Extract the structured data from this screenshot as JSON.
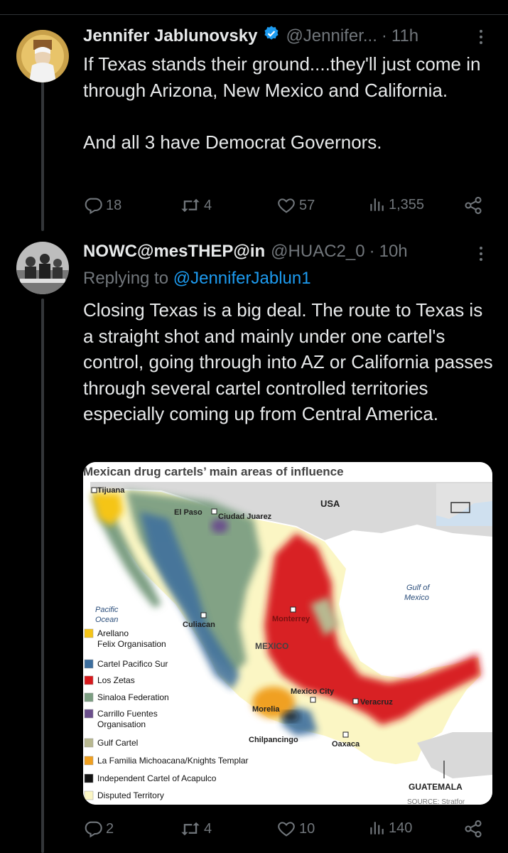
{
  "tweet1": {
    "name": "Jennifer Jablunovsky",
    "handle": "@Jennifer...",
    "time": "11h",
    "text": "If Texas stands their ground....they'll just come in through Arizona, New Mexico and California.\n\nAnd all 3 have Democrat Governors.",
    "replies": "18",
    "retweets": "4",
    "likes": "57",
    "views": "1,355"
  },
  "tweet2": {
    "name": "NOWC@mesTHEP@in",
    "handle": "@HUAC2_0",
    "time": "10h",
    "replying_prefix": "Replying to ",
    "replying_to": "@JenniferJablun1",
    "text": "Closing Texas is a big deal. The route to Texas is a straight shot and mainly under one cartel's control, going through into AZ or California passes through several cartel controlled territories especially coming up from Central America.",
    "replies": "2",
    "retweets": "4",
    "likes": "10",
    "views": "140"
  },
  "map": {
    "title": "Mexican drug cartels’ main areas of influence",
    "labels": {
      "tijuana": "Tijuana",
      "el_paso": "El Paso",
      "ciudad_juarez": "Ciudad Juarez",
      "usa": "USA",
      "gulf_1": "Gulf of",
      "gulf_2": "Mexico",
      "pacific_1": "Pacific",
      "pacific_2": "Ocean",
      "culiacan": "Culiacan",
      "monterrey": "Monterrey",
      "mexico": "MEXICO",
      "mexico_city": "Mexico City",
      "morelia": "Morelia",
      "veracruz": "Veracruz",
      "chilpancingo": "Chilpancingo",
      "oaxaca": "Oaxaca",
      "guatemala": "GUATEMALA",
      "source": "SOURCE: Stratfor"
    },
    "legend": [
      {
        "label1": "Arellano",
        "label2": "Felix Organisation",
        "color": "#f5c518"
      },
      {
        "label1": "Cartel Pacifico Sur",
        "label2": "",
        "color": "#3c6e9e"
      },
      {
        "label1": "Los Zetas",
        "label2": "",
        "color": "#d7191c"
      },
      {
        "label1": "Sinaloa Federation",
        "label2": "",
        "color": "#7c9e82"
      },
      {
        "label1": "Carrillo Fuentes",
        "label2": "Organisation",
        "color": "#6b4f8c"
      },
      {
        "label1": "Gulf Cartel",
        "label2": "",
        "color": "#b8b890"
      },
      {
        "label1": "La Familia Michoacana/Knights Templar",
        "label2": "",
        "color": "#f0a020"
      },
      {
        "label1": "Independent Cartel of Acapulco",
        "label2": "",
        "color": "#111111"
      },
      {
        "label1": "Disputed Territory",
        "label2": "",
        "color": "#fbf6c4"
      }
    ]
  }
}
